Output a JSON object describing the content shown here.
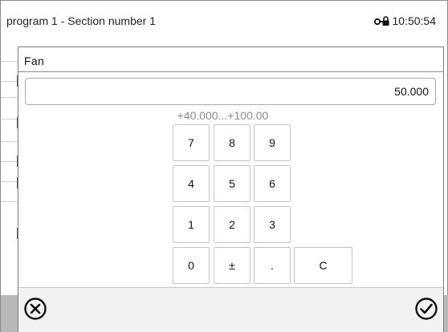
{
  "status_bar": {
    "title": "program 1 - Section number 1",
    "lock_icon": "key-lock-icon",
    "time": "10:50:54"
  },
  "dialog": {
    "title": "Fan",
    "value": "50.000",
    "range": "+40.000...+100.00",
    "keypad": {
      "row1": [
        "7",
        "8",
        "9"
      ],
      "row2": [
        "4",
        "5",
        "6"
      ],
      "row3": [
        "1",
        "2",
        "3"
      ],
      "row4": [
        "0",
        "±",
        ".",
        "C"
      ]
    },
    "footer": {
      "cancel_icon": "cancel-circle-icon",
      "confirm_icon": "confirm-check-circle-icon"
    }
  }
}
